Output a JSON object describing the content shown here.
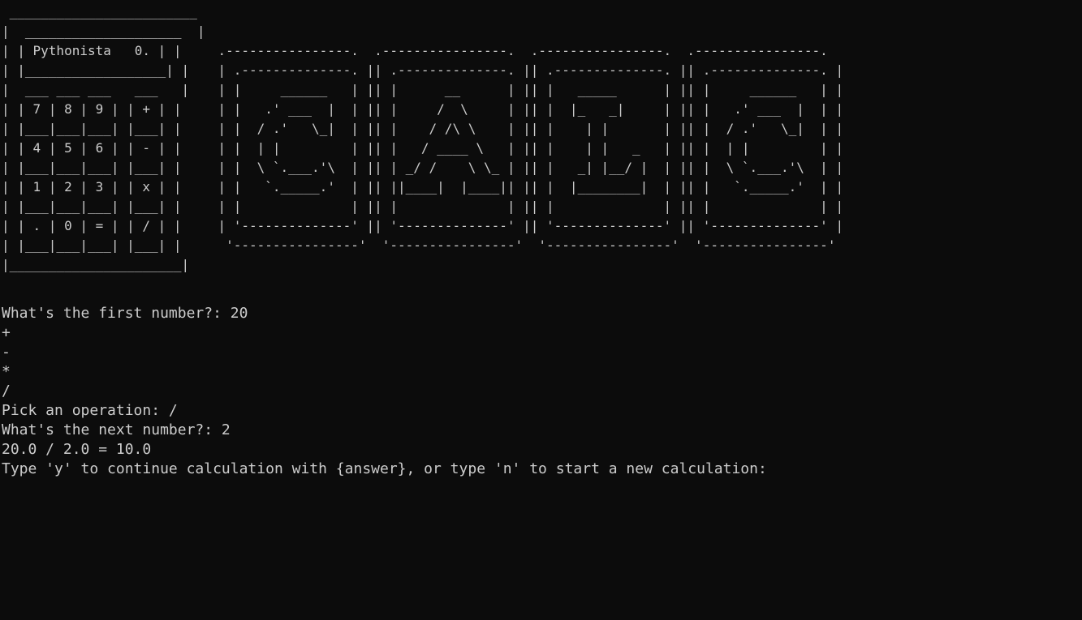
{
  "calculator_art": " ________________________\n|  ____________________  |\n| | Pythonista   0. | |\n| |__________________| |\n|  ___ ___ ___   ___   |\n| | 7 | 8 | 9 | | + | |\n| |___|___|___| |___| |\n| | 4 | 5 | 6 | | - | |\n| |___|___|___| |___| |\n| | 1 | 2 | 3 | | x | |\n| |___|___|___| |___| |\n| | . | 0 | = | | / | |\n| |___|___|___| |___| |\n|______________________|",
  "banner_art": ".----------------.  .----------------.  .----------------.  .----------------.\n| .--------------. || .--------------. || .--------------. || .--------------. |\n| |     ______   | || |      __      | || |   _____      | || |     ______   | |\n| |   .' ___  |  | || |     /  \\     | || |  |_   _|     | || |   .' ___  |  | |\n| |  / .'   \\_|  | || |    / /\\ \\    | || |    | |       | || |  / .'   \\_|  | |\n| |  | |         | || |   / ____ \\   | || |    | |   _   | || |  | |         | |\n| |  \\ `.___.'\\  | || | _/ /    \\ \\_ | || |   _| |__/ |  | || |  \\ `.___.'\\  | |\n| |   `._____.'  | || ||____|  |____|| || |  |________|  | || |   `._____.'  | |\n| |              | || |              | || |              | || |              | |\n| '--------------' || '--------------' || '--------------' || '--------------' |\n '----------------'  '----------------'  '----------------'  '----------------'",
  "output_lines": [
    "What's the first number?: 20",
    "+",
    "-",
    "*",
    "/",
    "Pick an operation: /",
    "What's the next number?: 2",
    "20.0 / 2.0 = 10.0",
    "Type 'y' to continue calculation with {answer}, or type 'n' to start a new calculation: "
  ],
  "colors": {
    "background": "#0c0c0c",
    "text": "#cccccc"
  }
}
